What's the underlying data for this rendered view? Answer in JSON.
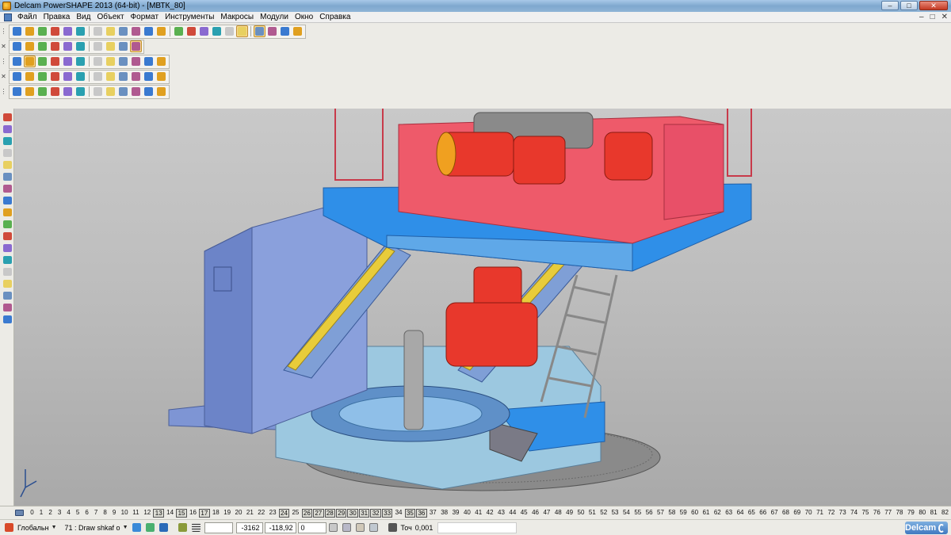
{
  "window": {
    "title": "Delcam PowerSHAPE 2013 (64-bit) - [МВТК_80]",
    "buttons": {
      "minimize": "–",
      "maximize": "□",
      "close": "✕"
    }
  },
  "menu": {
    "items": [
      "Файл",
      "Правка",
      "Вид",
      "Объект",
      "Формат",
      "Инструменты",
      "Макросы",
      "Модули",
      "Окно",
      "Справка"
    ],
    "mdi_buttons": {
      "minimize": "–",
      "restore": "□",
      "close": "✕"
    }
  },
  "toolbars": {
    "row1": [
      "new-file",
      "open-file",
      "save-file",
      "save-as",
      "print",
      "import",
      "cut",
      "copy",
      "paste",
      "delete",
      "undo",
      "redo",
      "measure",
      "select",
      "select-all",
      "snap-point",
      "shade",
      "wireframe",
      "dimension",
      "render",
      "workplane",
      "tools"
    ],
    "row2": [
      "view-front",
      "view-top",
      "view-iso",
      "view-rotate",
      "zoom-in",
      "zoom-out",
      "zoom-fit",
      "view-all",
      "shading-on",
      "lighting"
    ],
    "row3": [
      "solid",
      "extrude",
      "revolve",
      "boolean",
      "fillet",
      "shell",
      "draft",
      "pattern",
      "feature",
      "mirror",
      "scale",
      "assembly"
    ],
    "row4": [
      "surface",
      "curve",
      "section",
      "fill",
      "blend",
      "trim",
      "offset",
      "extend",
      "sweep",
      "loft",
      "drive",
      "analyze"
    ],
    "row5": [
      "line",
      "arc",
      "wireframe-curve",
      "curve-edit",
      "surface-build",
      "solid-build",
      "electrode",
      "symbol",
      "model-check",
      "wire-extract",
      "shell-solid",
      "face-draft"
    ]
  },
  "left_tools": [
    "select",
    "line",
    "arc",
    "curve",
    "surface",
    "solid",
    "copy",
    "move",
    "rotate",
    "mirror",
    "scale",
    "offset",
    "trim",
    "dimension",
    "text",
    "symbol",
    "assembly",
    "measure"
  ],
  "levels": {
    "items": [
      "0",
      "1",
      "2",
      "3",
      "4",
      "5",
      "6",
      "7",
      "8",
      "9",
      "10",
      "11",
      "12",
      "13",
      "14",
      "15",
      "16",
      "17",
      "18",
      "19",
      "20",
      "21",
      "22",
      "23",
      "24",
      "25",
      "26",
      "27",
      "28",
      "29",
      "30",
      "31",
      "32",
      "33",
      "34",
      "35",
      "36",
      "37",
      "38",
      "39",
      "40",
      "41",
      "42",
      "43",
      "44",
      "45",
      "46",
      "47",
      "48",
      "49",
      "50",
      "51",
      "52",
      "53",
      "54",
      "55",
      "56",
      "57",
      "58",
      "59",
      "60",
      "61",
      "62",
      "63",
      "64",
      "65",
      "66",
      "67",
      "68",
      "69",
      "70",
      "71",
      "72",
      "73",
      "74",
      "75",
      "76",
      "77",
      "78",
      "79",
      "80",
      "81",
      "82"
    ],
    "active": [
      "13",
      "15",
      "17",
      "24",
      "26",
      "27",
      "28",
      "29",
      "30",
      "31",
      "32",
      "33",
      "35",
      "36"
    ]
  },
  "status": {
    "coord_system": "Глобальн",
    "level_label": "71 : Draw shkaf o",
    "x": "-3162",
    "y": "-118,92",
    "z": "0",
    "tolerance_label": "Точ",
    "tolerance": "0,001",
    "brand": "Delcam"
  },
  "colors": {
    "machine_red": "#e8382c",
    "platform_blue": "#2f8fe8",
    "frame_blue": "#7f9fd6",
    "bracket_yellow": "#e8cc3a",
    "cabinet_blue": "#8aa0dc",
    "viewport_bg": "#c0c0c0"
  }
}
